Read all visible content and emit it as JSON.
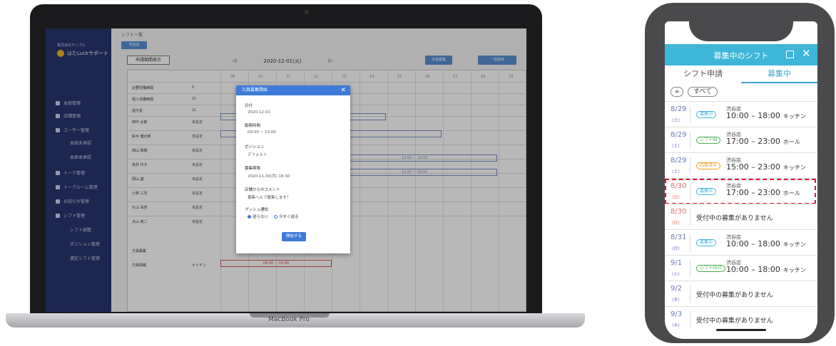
{
  "laptop": {
    "brand": "MacBook Pro",
    "sidebar": {
      "company": "株式会社サンプル",
      "app_name": "はたLuckサポート",
      "items": [
        {
          "label": "本部管理",
          "sub": false
        },
        {
          "label": "店舗管理",
          "sub": false
        },
        {
          "label": "ユーザー管理",
          "sub": false
        },
        {
          "label": "本部未承認",
          "sub": true
        },
        {
          "label": "本部本承認",
          "sub": true
        },
        {
          "label": "トーク管理",
          "sub": false
        },
        {
          "label": "トークルーム管理",
          "sub": false
        },
        {
          "label": "お知らせ管理",
          "sub": false
        },
        {
          "label": "シフト管理",
          "sub": false
        },
        {
          "label": "シフト調整",
          "sub": true
        },
        {
          "label": "ポジション管理",
          "sub": true
        },
        {
          "label": "選定シフト管理",
          "sub": true
        }
      ]
    },
    "header": {
      "breadcrumb": "シフト一覧",
      "store_button": "渋谷店",
      "request_button": "申請期間表示",
      "prev": "◁",
      "date": "2020-12-01(火)",
      "next": "▷",
      "vacancy_button": "欠員募集",
      "save_button": "一括保存"
    },
    "grid": {
      "hours": [
        "09",
        "10",
        "11",
        "12",
        "13",
        "14",
        "15",
        "16",
        "17",
        "18",
        "19"
      ],
      "rows": [
        {
          "name": "必要労働時間",
          "num": "0"
        },
        {
          "name": "個人労働時間",
          "num": "21"
        },
        {
          "name": "過不足",
          "num": "21"
        },
        {
          "name": "田中 太郎",
          "num": "未設定"
        },
        {
          "name": "鈴木 健太郎",
          "num": "未設定"
        },
        {
          "name": "田山 和樹",
          "num": "未設定"
        },
        {
          "name": "高井 玲子",
          "num": "未設定"
        },
        {
          "name": "岡山 誠",
          "num": "未設定"
        },
        {
          "name": "小林 三月",
          "num": "未設定"
        },
        {
          "name": "久山 百佳",
          "num": "未設定"
        },
        {
          "name": "大山 晃二",
          "num": "未設定"
        }
      ],
      "shift_labels": [
        "13:00 ~ 19:00",
        "13:00 ~ 19:00"
      ],
      "recruit_label": "欠員募集",
      "recruit_row_name": "欠員情報",
      "recruit_position": "キッチン",
      "recruit_bar": "09:00 ~ 13:00"
    },
    "modal": {
      "title": "欠員募集開始",
      "close": "✕",
      "date_label": "日付",
      "date_value": "2020-12-01",
      "time_label": "勤務時間",
      "time_value": "09:00 ~ 13:00",
      "position_label": "ポジション",
      "position_value": "デフォルト",
      "deadline_label": "募集期限",
      "deadline_value": "2020-11-30(月) 18:30",
      "comment_label": "店舗からのコメント",
      "comment_value": "募集ヘルプ募集します！",
      "push_label": "プッシュ通知",
      "push_option_off": "送らない",
      "push_option_on": "今すぐ送る",
      "submit": "開始する"
    }
  },
  "phone": {
    "title": "募集中のシフト",
    "close": "✕",
    "tabs": [
      "シフト申請",
      "募集中"
    ],
    "active_tab": 1,
    "filter_icon": "≡",
    "filter_all": "すべて",
    "rows": [
      {
        "date": "8/29",
        "dow": "(土)",
        "badge": "募集中",
        "badge_color": "#3eb6d9",
        "store": "渋谷店",
        "time": "10:00 – 18:00",
        "position": "キッチン",
        "red": false,
        "highlight": false
      },
      {
        "date": "8/29",
        "dow": "(土)",
        "badge": "シフトIN",
        "badge_color": "#4caf50",
        "store": "渋谷店",
        "time": "17:00 – 23:00",
        "position": "ホール",
        "red": false,
        "highlight": false
      },
      {
        "date": "8/29",
        "dow": "(土)",
        "badge": "応募済み",
        "badge_color": "#f0a020",
        "store": "渋谷店",
        "time": "15:00 – 23:00",
        "position": "キッチン",
        "red": false,
        "highlight": false
      },
      {
        "date": "8/30",
        "dow": "(日)",
        "badge": "募集中",
        "badge_color": "#3eb6d9",
        "store": "渋谷店",
        "time": "17:00 – 23:00",
        "position": "ホール",
        "red": true,
        "highlight": true
      },
      {
        "date": "8/30",
        "dow": "(日)",
        "none": "受付中の募集がありません",
        "red": true
      },
      {
        "date": "8/31",
        "dow": "(月)",
        "badge": "募集中",
        "badge_color": "#3eb6d9",
        "store": "渋谷店",
        "time": "10:00 – 18:00",
        "position": "キッチン",
        "red": false,
        "highlight": false
      },
      {
        "date": "9/1",
        "dow": "(火)",
        "badge": "シフトOUT",
        "badge_color": "#4caf50",
        "store": "渋谷店",
        "time": "10:00 – 18:00",
        "position": "キッチン",
        "red": false,
        "highlight": false
      },
      {
        "date": "9/2",
        "dow": "(水)",
        "none": "受付中の募集がありません",
        "red": false
      },
      {
        "date": "9/3",
        "dow": "(木)",
        "none": "受付中の募集がありません",
        "red": false
      }
    ]
  }
}
